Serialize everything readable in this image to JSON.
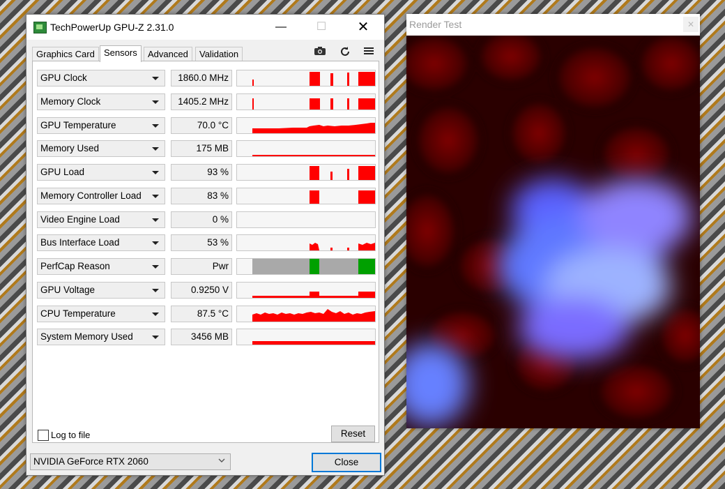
{
  "gpuz": {
    "title": "TechPowerUp GPU-Z 2.31.0",
    "window_buttons": {
      "minimize": "—",
      "maximize": "☐",
      "close": "✕"
    },
    "tabs": [
      "Graphics Card",
      "Sensors",
      "Advanced",
      "Validation"
    ],
    "active_tab": "Sensors",
    "toolbar_icons": [
      "camera-icon",
      "refresh-icon",
      "menu-icon"
    ],
    "sensors": [
      {
        "name": "GPU Clock",
        "value": "1860.0 MHz"
      },
      {
        "name": "Memory Clock",
        "value": "1405.2 MHz"
      },
      {
        "name": "GPU Temperature",
        "value": "70.0 °C"
      },
      {
        "name": "Memory Used",
        "value": "175 MB"
      },
      {
        "name": "GPU Load",
        "value": "93 %"
      },
      {
        "name": "Memory Controller Load",
        "value": "83 %"
      },
      {
        "name": "Video Engine Load",
        "value": "0 %"
      },
      {
        "name": "Bus Interface Load",
        "value": "53 %"
      },
      {
        "name": "PerfCap Reason",
        "value": "Pwr"
      },
      {
        "name": "GPU Voltage",
        "value": "0.9250 V"
      },
      {
        "name": "CPU Temperature",
        "value": "87.5 °C"
      },
      {
        "name": "System Memory Used",
        "value": "3456 MB"
      }
    ],
    "log_to_file_label": "Log to file",
    "log_to_file_checked": false,
    "reset_label": "Reset",
    "gpu_select_value": "NVIDIA GeForce RTX 2060",
    "close_label": "Close",
    "graph_color": "#ff0000",
    "perfcap_colors": {
      "idle": "#a9a9a9",
      "pwr": "#00a000"
    }
  },
  "render_test": {
    "title": "Render Test",
    "close_label": "✕"
  }
}
